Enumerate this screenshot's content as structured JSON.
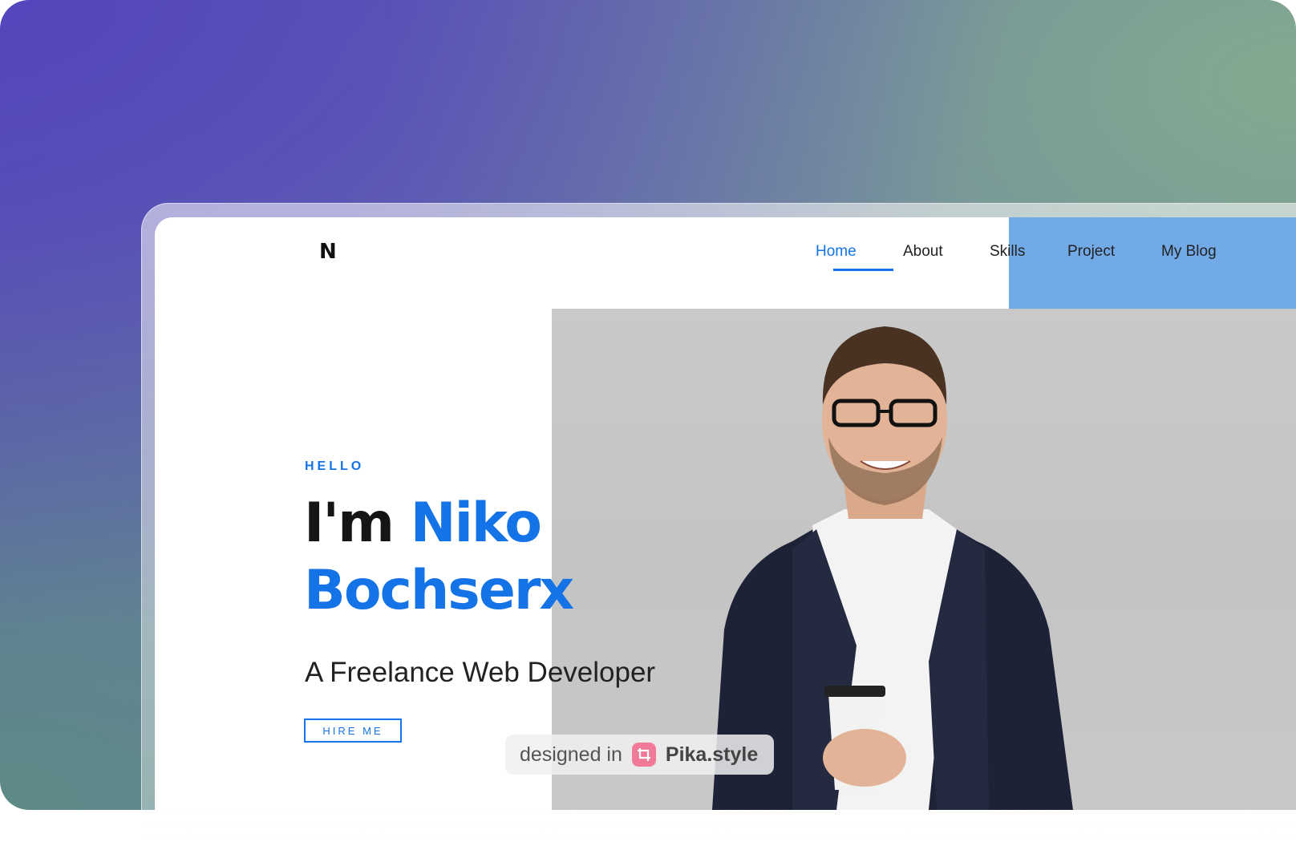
{
  "site": {
    "logo": "N"
  },
  "nav": {
    "items": [
      {
        "label": "Home",
        "active": true
      },
      {
        "label": "About",
        "active": false
      },
      {
        "label": "Skills",
        "active": false
      },
      {
        "label": "Project",
        "active": false
      },
      {
        "label": "My Blog",
        "active": false
      }
    ],
    "highlight_color": "#72aae8"
  },
  "hero": {
    "eyebrow": "HELLO",
    "headline_prefix": "I'm",
    "headline_first_name": "Niko",
    "headline_last_name": "Bochserx",
    "subtitle": "A Freelance Web Developer",
    "cta_label": "HIRE ME",
    "photo": "portrait-man-glasses-coffee-icon"
  },
  "watermark": {
    "prefix": "designed in",
    "brand": "Pika.style",
    "icon": "crop-icon"
  },
  "colors": {
    "accent": "#1473e6",
    "text": "#151515"
  }
}
